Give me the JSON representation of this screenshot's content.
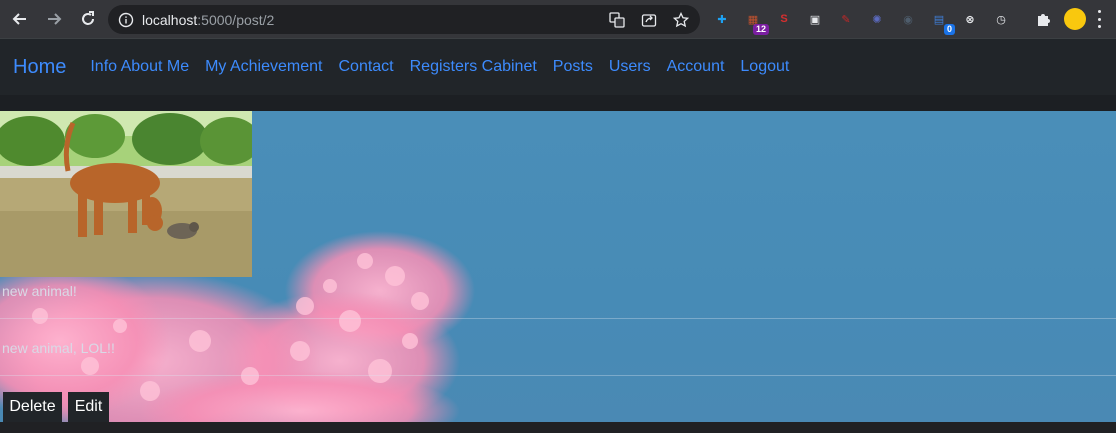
{
  "browser": {
    "url_host": "localhost",
    "url_path": ":5000/post/2",
    "icons": [
      "back-arrow-icon",
      "forward-arrow-icon",
      "reload-icon",
      "info-icon",
      "translate-icon",
      "share-icon",
      "bookmark-star-icon",
      "puzzle-extensions-icon",
      "profile-avatar-icon",
      "kebab-menu-icon"
    ],
    "extensions": [
      {
        "name": "plus-extension-icon",
        "color": "#1da1f2",
        "glyph": "✚"
      },
      {
        "name": "folder-extension-icon",
        "color": "#c0522f",
        "glyph": "▦",
        "badge": "12"
      },
      {
        "name": "s-extension-icon",
        "color": "#d62f2f",
        "glyph": "S"
      },
      {
        "name": "window-extension-icon",
        "color": "#e8eaed",
        "glyph": "▣"
      },
      {
        "name": "wand-extension-icon",
        "color": "#c62828",
        "glyph": "✎"
      },
      {
        "name": "gear-extension-icon",
        "color": "#5c6bc0",
        "glyph": "✺"
      },
      {
        "name": "spy-extension-icon",
        "color": "#4e5d6c",
        "glyph": "◉"
      },
      {
        "name": "doc-extension-icon",
        "color": "#3f7fd8",
        "glyph": "▤",
        "badge": "0"
      },
      {
        "name": "circle-x-extension-icon",
        "color": "#e8eaed",
        "glyph": "⊗"
      },
      {
        "name": "clock-extension-icon",
        "color": "#e8eaed",
        "glyph": "◷"
      }
    ]
  },
  "navbar": {
    "brand": "Home",
    "links": [
      "Info About Me",
      "My Achievement",
      "Contact",
      "Registers Cabinet",
      "Posts",
      "Users",
      "Account",
      "Logout"
    ]
  },
  "post": {
    "title": "new animal!",
    "body": "new animal, LOL!!",
    "delete_label": "Delete",
    "edit_label": "Edit"
  },
  "colors": {
    "link": "#3d8bfd",
    "navbar_bg": "#212529",
    "sky": "#4a8eb8",
    "blossom": "#f48fb1"
  }
}
